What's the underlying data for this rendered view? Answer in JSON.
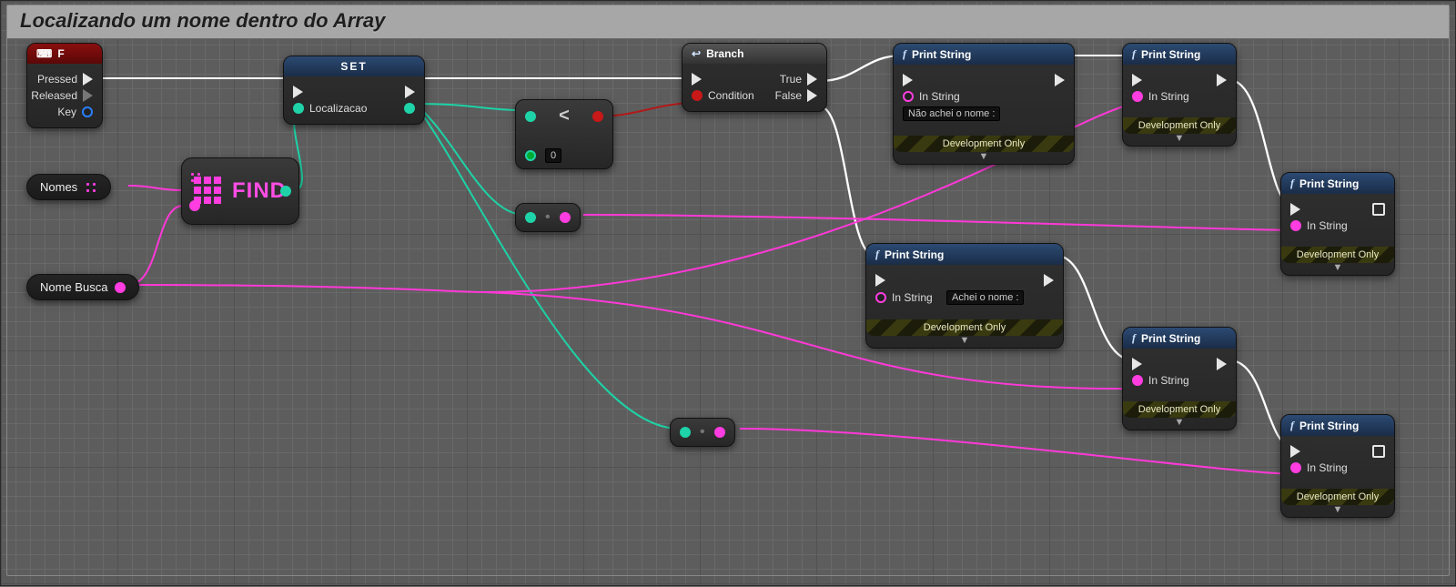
{
  "comment": {
    "title": "Localizando um nome dentro do Array"
  },
  "event": {
    "key": "F",
    "pins": {
      "pressed": "Pressed",
      "released": "Released",
      "key_out": "Key"
    }
  },
  "set": {
    "title": "SET",
    "var": "Localizacao"
  },
  "vars": {
    "nomes": "Nomes",
    "nome_busca": "Nome Busca"
  },
  "find": {
    "label": "FIND"
  },
  "less": {
    "op": "<",
    "b_value": "0"
  },
  "branch": {
    "title": "Branch",
    "cond": "Condition",
    "true": "True",
    "false": "False"
  },
  "print_true": {
    "title": "Print String",
    "in_string_label": "In String",
    "in_string_value": "Não achei o nome :",
    "dev": "Development Only"
  },
  "print_true2": {
    "title": "Print String",
    "in_string_label": "In String",
    "dev": "Development Only"
  },
  "print_true3": {
    "title": "Print String",
    "in_string_label": "In String",
    "dev": "Development Only"
  },
  "print_false": {
    "title": "Print String",
    "in_string_label": "In String",
    "in_string_value": "Achei o nome :",
    "dev": "Development Only"
  },
  "print_false2": {
    "title": "Print String",
    "in_string_label": "In String",
    "dev": "Development Only"
  },
  "print_false3": {
    "title": "Print String",
    "in_string_label": "In String",
    "dev": "Development Only"
  }
}
